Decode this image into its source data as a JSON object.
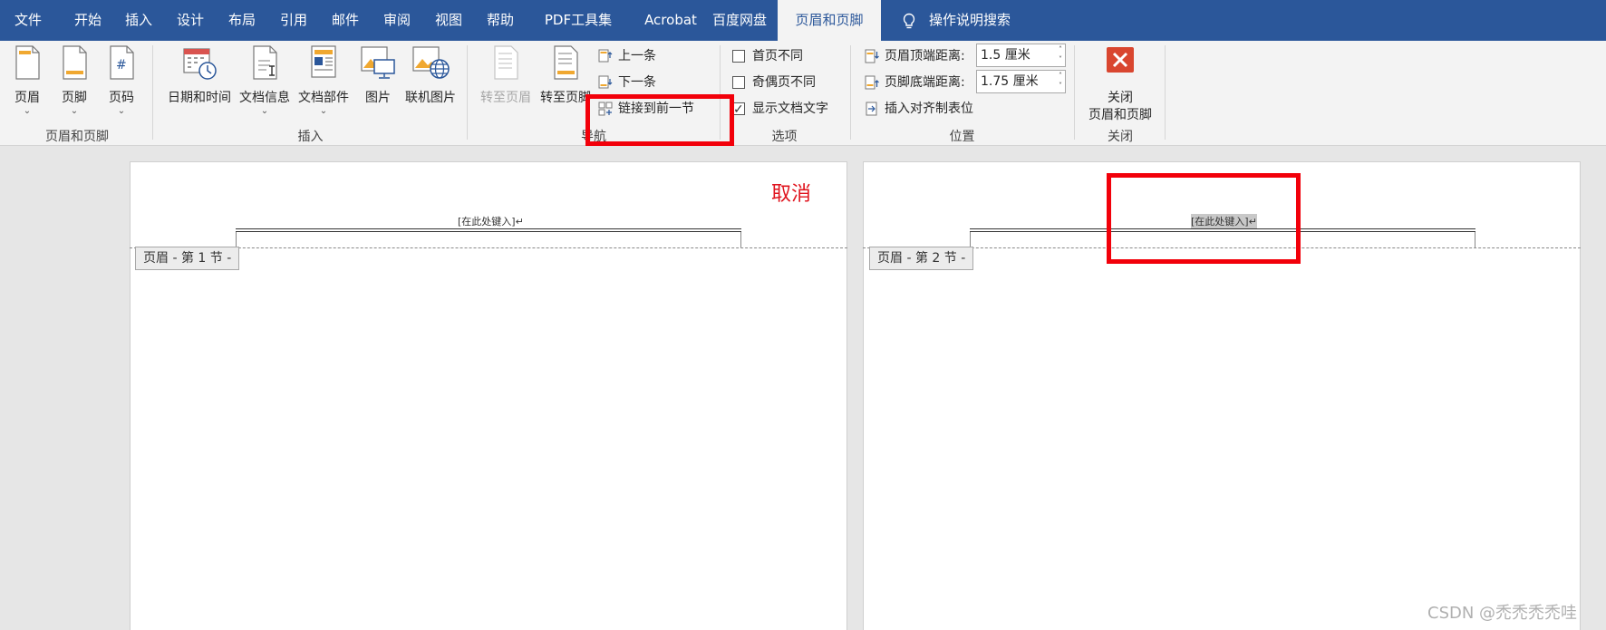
{
  "menu": {
    "tabs": [
      "文件",
      "开始",
      "插入",
      "设计",
      "布局",
      "引用",
      "邮件",
      "审阅",
      "视图",
      "帮助",
      "PDF工具集",
      "Acrobat",
      "百度网盘",
      "页眉和页脚"
    ],
    "active_tab": "页眉和页脚",
    "tell_me": "操作说明搜索"
  },
  "ribbon": {
    "groups": {
      "header_footer": "页眉和页脚",
      "insert": "插入",
      "navigation": "导航",
      "options": "选项",
      "position": "位置",
      "close": "关闭"
    },
    "buttons": {
      "header": "页眉",
      "footer": "页脚",
      "page_number": "页码",
      "date_time": "日期和时间",
      "doc_info": "文档信息",
      "doc_parts": "文档部件",
      "picture": "图片",
      "online_picture": "联机图片",
      "goto_header": "转至页眉",
      "goto_footer": "转至页脚",
      "previous": "上一条",
      "next": "下一条",
      "link_to_previous": "链接到前一节",
      "close_line1": "关闭",
      "close_line2": "页眉和页脚"
    },
    "options": {
      "first_page": "首页不同",
      "odd_even": "奇偶页不同",
      "show_doc_text": "显示文档文字"
    },
    "position": {
      "header_top_label": "页眉顶端距离:",
      "header_top_value": "1.5 厘米",
      "footer_bottom_label": "页脚底端距离:",
      "footer_bottom_value": "1.75 厘米",
      "insert_align_tab": "插入对齐制表位"
    }
  },
  "document": {
    "page1": {
      "header_tag": "页眉 - 第 1 节 -",
      "placeholder": "[在此处键入]↵"
    },
    "page2": {
      "header_tag": "页眉 - 第 2 节 -",
      "placeholder": "[在此处键入]↵"
    }
  },
  "annotation": "取消",
  "watermark": "CSDN @禿禿禿禿哇"
}
